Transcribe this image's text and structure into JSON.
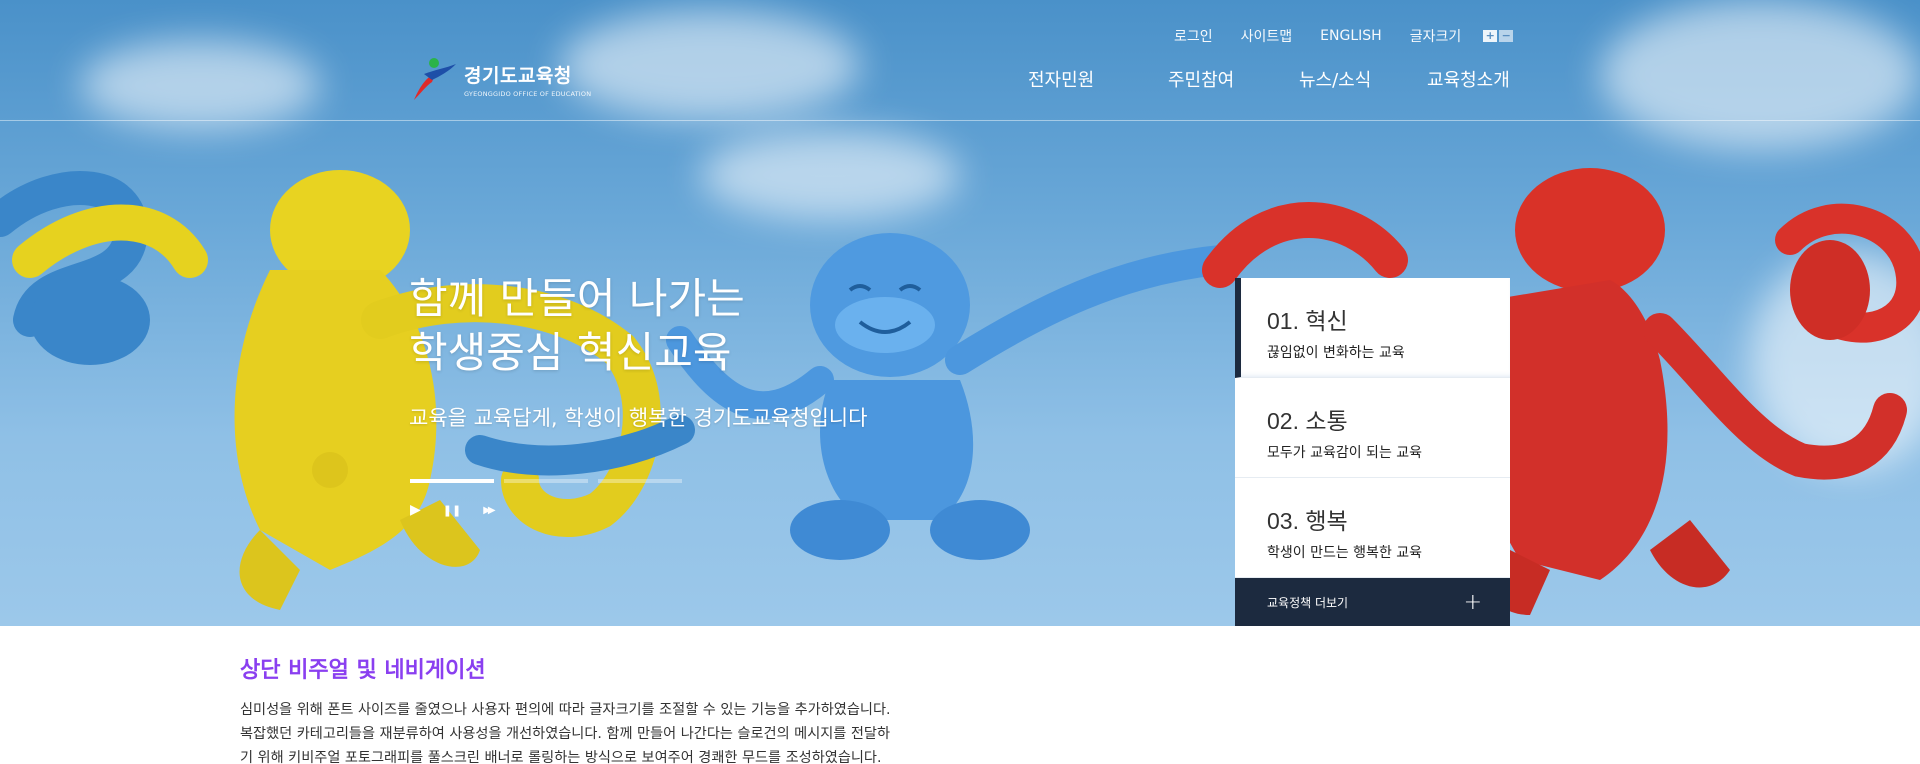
{
  "utility_nav": {
    "login": "로그인",
    "sitemap": "사이트맵",
    "english": "ENGLISH",
    "font_size_label": "글자크기",
    "font_increase": "+",
    "font_decrease": "−"
  },
  "logo": {
    "title": "경기도교육청",
    "subtitle": "GYEONGGIDO OFFICE OF EDUCATION"
  },
  "gnb": [
    {
      "label": "전자민원"
    },
    {
      "label": "주민참여"
    },
    {
      "label": "뉴스/소식"
    },
    {
      "label": "교육청소개"
    }
  ],
  "hero": {
    "headline_line1": "함께 만들어 나가는",
    "headline_line2": "학생중심 혁신교육",
    "subline": "교육을 교육답게, 학생이 행복한 경기도교육청입니다",
    "slide_count": 3,
    "active_slide": 1,
    "controls": {
      "play": "▶",
      "pause": "❚❚",
      "next": "▶▶"
    }
  },
  "policy": {
    "items": [
      {
        "num": "01. 혁신",
        "desc": "끊임없이 변화하는 교육"
      },
      {
        "num": "02. 소통",
        "desc": "모두가 교육감이 되는 교육"
      },
      {
        "num": "03. 행복",
        "desc": "학생이 만드는 행복한 교육"
      }
    ],
    "more_label": "교육정책 더보기",
    "more_icon": "+"
  },
  "description": {
    "title": "상단 비주얼 및 네비게이션",
    "lines": [
      "심미성을 위해 폰트 사이즈를 줄였으나 사용자 편의에 따라 글자크기를 조절할 수 있는 기능을 추가하였습니다.",
      "복잡했던 카테고리들을 재분류하여 사용성을 개선하였습니다. 함께 만들어 나간다는 슬로건의 메시지를 전달하",
      "기 위해 키비주얼 포토그래피를 풀스크린 배너로 롤링하는 방식으로 보여주어 경쾌한 무드를 조성하였습니다."
    ]
  },
  "colors": {
    "navy": "#1c2a3f",
    "accent_purple": "#8a3ff0",
    "sky": "#6aa8d8"
  }
}
